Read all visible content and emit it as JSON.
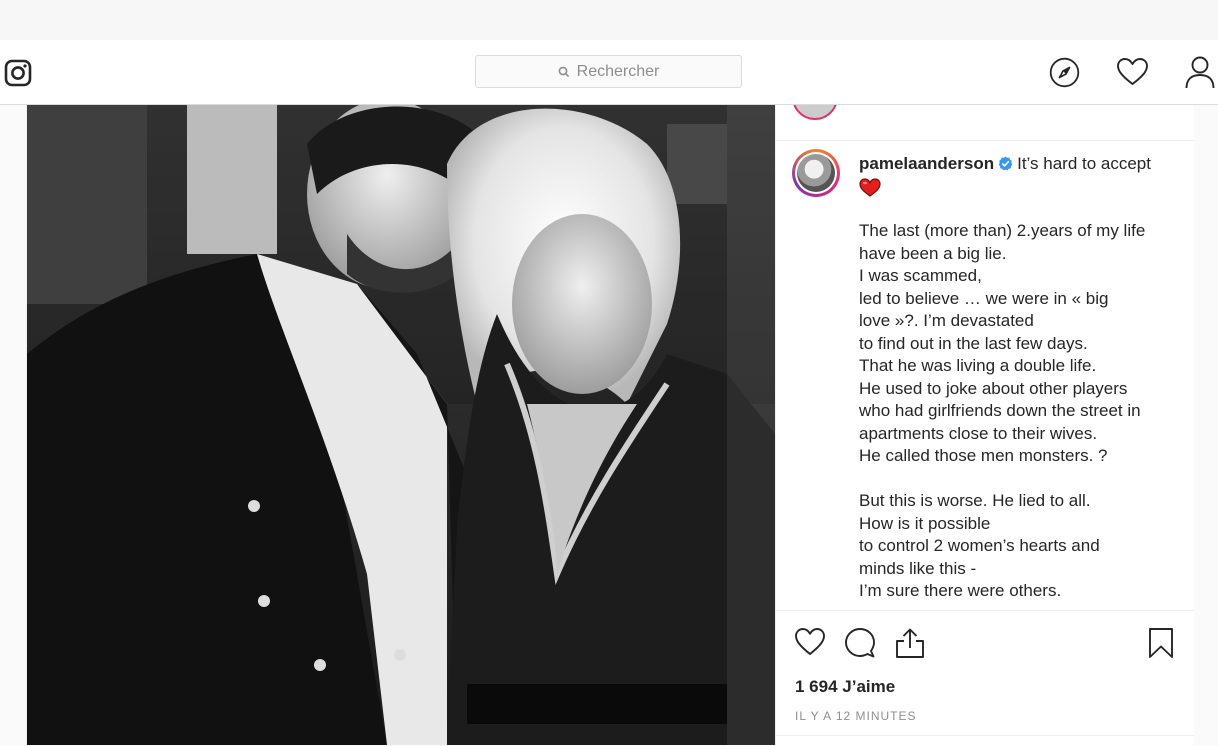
{
  "search": {
    "placeholder": "Rechercher"
  },
  "nav": {
    "icons": [
      "instagram-logo-icon",
      "compass-icon",
      "heart-icon",
      "profile-icon"
    ]
  },
  "post": {
    "username": "pamelaanderson",
    "verified": true,
    "caption_first": "It’s hard to accept",
    "caption_lines": [
      "",
      "The last (more than) 2.years of my life",
      "have been a big lie.",
      "I was scammed,",
      "led to believe … we were in « big",
      "love »?. I’m devastated",
      "to find out in the last few days.",
      "That he was living a double life.",
      "He used to joke about other players",
      "who had girlfriends down the street in",
      "apartments close to their wives.",
      "He called those men monsters. ?",
      "",
      "But this is worse. He lied to all.",
      "How is it possible",
      "to control 2 women’s hearts and",
      "minds like this -",
      "I’m sure there were others."
    ],
    "likes": "1 694 J’aime",
    "time_ago": "IL Y A 12 MINUTES"
  },
  "colors": {
    "accent_verified": "#3897f0",
    "text": "#262626",
    "muted": "#8e8e8e",
    "heart": "#e0201b"
  }
}
